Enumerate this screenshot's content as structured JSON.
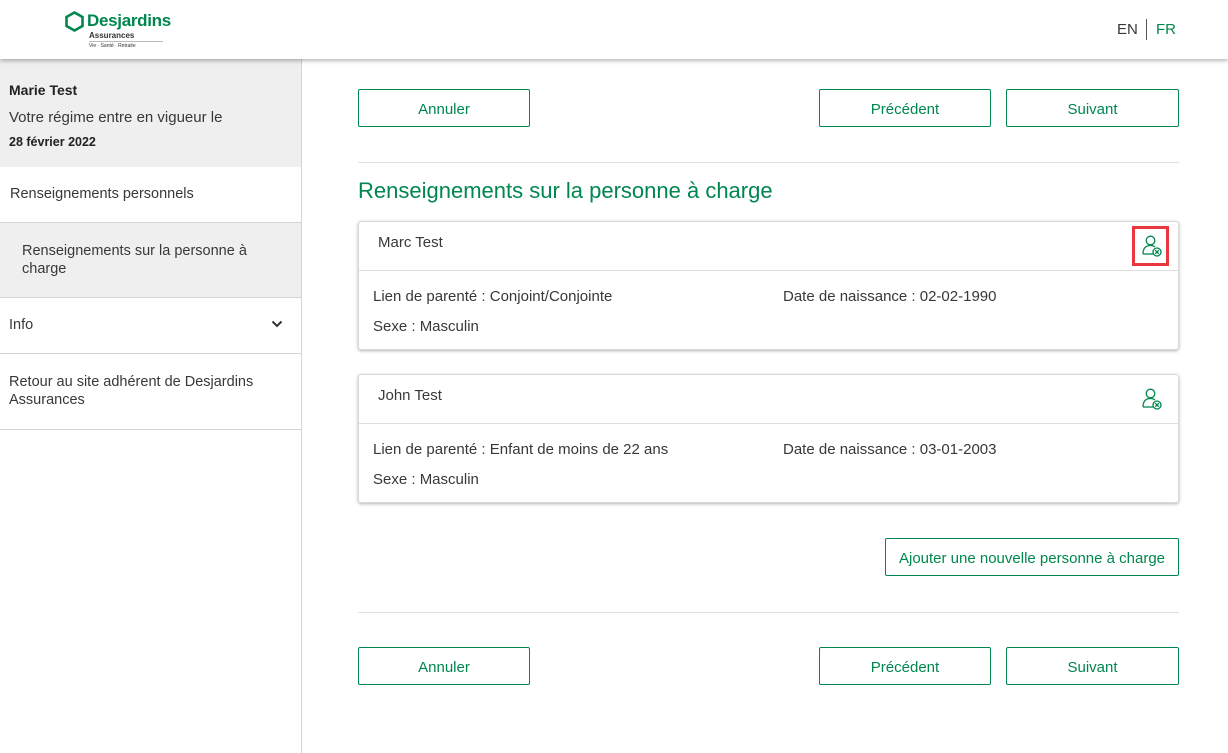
{
  "header": {
    "logo": {
      "name": "Desjardins",
      "sub": "Assurances",
      "tagline": "Vie · Santé · Retraite"
    },
    "lang_en": "EN",
    "lang_fr": "FR",
    "brand_color": "#00874e"
  },
  "sidebar": {
    "user_name": "Marie Test",
    "plan_line": "Votre régime entre en vigueur le",
    "plan_date": "28 février 2022",
    "items": [
      {
        "label": "Renseignements personnels"
      },
      {
        "label": "Renseignements sur la personne à charge",
        "active": true
      },
      {
        "label": "Info",
        "icon": "chevron-down-icon"
      },
      {
        "label": "Retour au site adhérent de Desjardins Assurances"
      }
    ]
  },
  "buttons": {
    "cancel": "Annuler",
    "previous": "Précédent",
    "next": "Suivant",
    "add_dependent": "Ajouter une nouvelle personne à charge"
  },
  "main": {
    "title": "Renseignements sur la personne à charge",
    "dependents": [
      {
        "name": "Marc Test",
        "relation": "Lien de parenté : Conjoint/Conjointe",
        "sex": "Sexe : Masculin",
        "dob": "Date de naissance : 02-02-1990",
        "icon": "remove-person-icon",
        "highlighted": true
      },
      {
        "name": "John Test",
        "relation": "Lien de parenté : Enfant de moins de 22 ans",
        "sex": "Sexe : Masculin",
        "dob": "Date de naissance : 03-01-2003",
        "icon": "remove-person-icon"
      }
    ]
  }
}
